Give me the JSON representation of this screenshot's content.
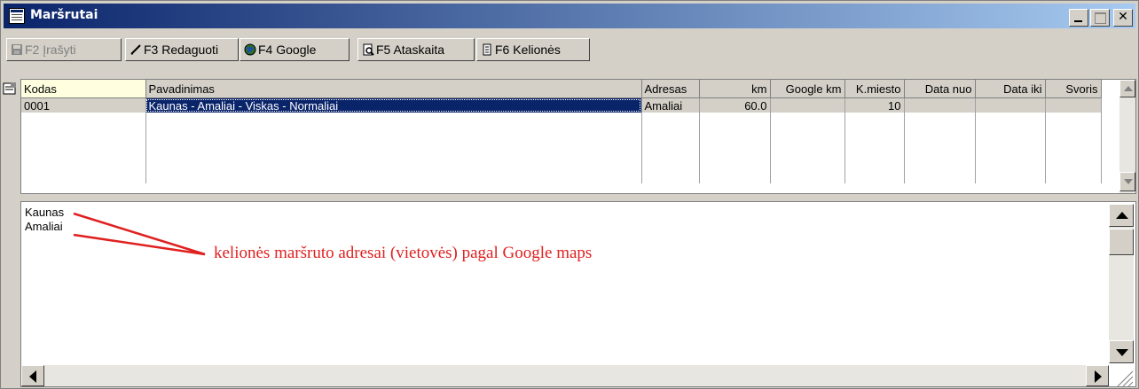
{
  "window": {
    "title": "Maršrutai"
  },
  "toolbar": {
    "buttons": [
      {
        "key": "F2",
        "label": "F2 Įrašyti",
        "enabled": false
      },
      {
        "key": "F3",
        "label": "F3 Redaguoti",
        "enabled": true
      },
      {
        "key": "F4",
        "label": "F4 Google",
        "enabled": true
      },
      {
        "key": "F5",
        "label": "F5 Ataskaita",
        "enabled": true
      },
      {
        "key": "F6",
        "label": "F6 Kelionės",
        "enabled": true
      }
    ]
  },
  "grid": {
    "columns": [
      "Kodas",
      "Pavadinimas",
      "Adresas",
      "km",
      "Google km",
      "K.miesto",
      "Data nuo",
      "Data iki",
      "Svoris"
    ],
    "rows": [
      {
        "kodas": "0001",
        "pavadinimas": "Kaunas - Amaliai - Viskas - Normaliai",
        "adresas": "Amaliai",
        "km": "60.0",
        "google_km": "",
        "k_miesto": "10",
        "data_nuo": "",
        "data_iki": "",
        "svoris": ""
      }
    ]
  },
  "memo": {
    "lines": [
      "Kaunas",
      "Amaliai"
    ]
  },
  "annotation": {
    "text": "kelionės maršruto adresai (vietovės) pagal Google maps",
    "color": "#e02020"
  }
}
